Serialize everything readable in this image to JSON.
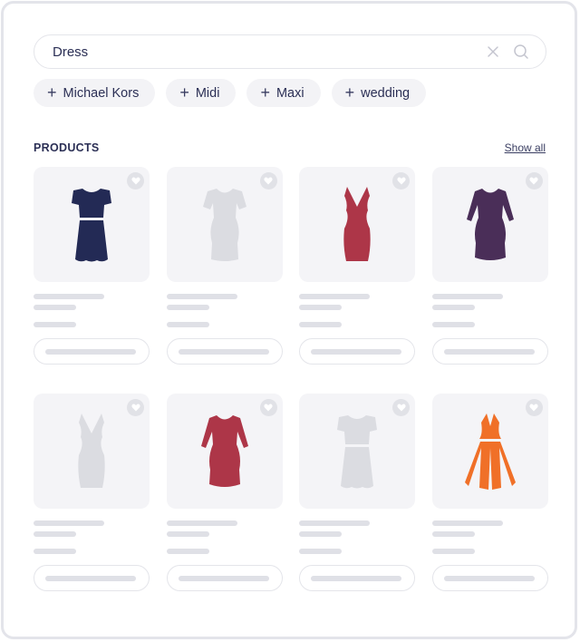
{
  "search": {
    "value": "Dress",
    "clear_icon": "close-icon",
    "search_icon": "search-icon"
  },
  "chips": [
    {
      "label": "Michael Kors",
      "icon": "plus-icon"
    },
    {
      "label": "Midi",
      "icon": "plus-icon"
    },
    {
      "label": "Maxi",
      "icon": "plus-icon"
    },
    {
      "label": "wedding",
      "icon": "plus-icon"
    }
  ],
  "products": {
    "title": "PRODUCTS",
    "show_all_label": "Show all",
    "items": [
      {
        "style": "tshirt-dress-belted",
        "color": "#232a55"
      },
      {
        "style": "short-sleeve-sheath",
        "color": "#dbdce1"
      },
      {
        "style": "v-neck-bodycon",
        "color": "#ad3648"
      },
      {
        "style": "long-sleeve-sheath",
        "color": "#4a2e58"
      },
      {
        "style": "v-neck-bodycon",
        "color": "#dbdce1"
      },
      {
        "style": "long-sleeve-sheath",
        "color": "#ad3648"
      },
      {
        "style": "tshirt-dress-belted",
        "color": "#dbdce1"
      },
      {
        "style": "halter-flared",
        "color": "#f07028"
      }
    ]
  }
}
